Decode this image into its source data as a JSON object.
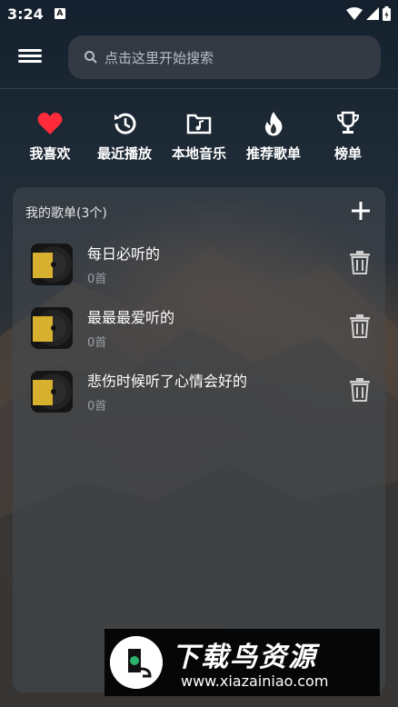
{
  "status": {
    "time": "3:24",
    "notif_badge": "A"
  },
  "search": {
    "placeholder": "点击这里开始搜索"
  },
  "nav": [
    {
      "label": "我喜欢",
      "icon": "heart-icon"
    },
    {
      "label": "最近播放",
      "icon": "history-icon"
    },
    {
      "label": "本地音乐",
      "icon": "music-folder-icon"
    },
    {
      "label": "推荐歌单",
      "icon": "flame-icon"
    },
    {
      "label": "榜单",
      "icon": "trophy-icon"
    }
  ],
  "playlists": {
    "header": "我的歌单(3个)",
    "items": [
      {
        "title": "每日必听的",
        "count": "0首"
      },
      {
        "title": "最最最爱听的",
        "count": "0首"
      },
      {
        "title": "悲伤时候听了心情会好的",
        "count": "0首"
      }
    ]
  },
  "watermark": {
    "title": "下载鸟资源",
    "url": "www.xiazainiao.com"
  },
  "colors": {
    "heart": "#ff2b3b",
    "accent_gold": "#d8b030",
    "card_bg": "#464a50"
  }
}
